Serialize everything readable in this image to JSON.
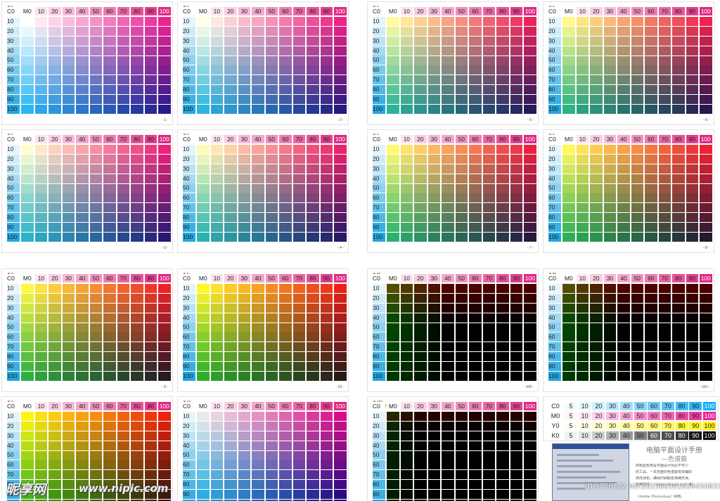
{
  "columns": [
    "M0",
    "10",
    "20",
    "30",
    "40",
    "50",
    "60",
    "70",
    "80",
    "90",
    "100"
  ],
  "rows": [
    "C0",
    "10",
    "20",
    "30",
    "40",
    "50",
    "60",
    "70",
    "80",
    "90",
    "100"
  ],
  "charts": [
    {
      "b": "B 0",
      "y": "Y 0",
      "yv": 0,
      "bv": 0,
      "page": "- 1 -"
    },
    {
      "b": "B 0",
      "y": "Y 10",
      "yv": 10,
      "bv": 0,
      "page": "- 2 -"
    },
    {
      "b": "B 0",
      "y": "Y 40",
      "yv": 40,
      "bv": 0,
      "page": "- 5 -"
    },
    {
      "b": "B 0",
      "y": "Y 50",
      "yv": 50,
      "bv": 0,
      "page": "- 6 -"
    },
    {
      "b": "B 0",
      "y": "Y 20",
      "yv": 20,
      "bv": 0,
      "page": "- 3 -"
    },
    {
      "b": "B 0",
      "y": "Y 30",
      "yv": 30,
      "bv": 0,
      "page": "- 4 -"
    },
    {
      "b": "B 0",
      "y": "Y 60",
      "yv": 60,
      "bv": 0,
      "page": "- 7 -"
    },
    {
      "b": "B 0",
      "y": "Y 70",
      "yv": 70,
      "bv": 0,
      "page": "- 8 -"
    },
    {
      "b": "B 0",
      "y": "Y 80",
      "yv": 80,
      "bv": 0,
      "page": "- 9 -"
    },
    {
      "b": "B 0",
      "y": "Y 90",
      "yv": 90,
      "bv": 0,
      "page": "- 10 -"
    },
    {
      "b": "B 80",
      "y": "Y 90",
      "yv": 90,
      "bv": 80,
      "page": "- 109 -"
    },
    {
      "b": "B 80",
      "y": "Y 100",
      "yv": 100,
      "bv": 80,
      "page": "- 110 -"
    },
    {
      "b": "B 0",
      "y": "Y 100",
      "yv": 100,
      "bv": 0,
      "page": ""
    },
    {
      "b": "B 10",
      "y": "Y 0",
      "yv": 0,
      "bv": 10,
      "page": ""
    },
    {
      "b": "B 100",
      "y": "Y 0-100",
      "yv": 50,
      "bv": 100,
      "page": ""
    }
  ],
  "bank": {
    "values": [
      "5",
      "10",
      "20",
      "30",
      "40",
      "50",
      "60",
      "70",
      "80",
      "90",
      "100"
    ],
    "rows": [
      {
        "label": "C0",
        "kind": "c"
      },
      {
        "label": "M0",
        "kind": "m"
      },
      {
        "label": "Y0",
        "kind": "y"
      },
      {
        "label": "K0",
        "kind": "k"
      }
    ]
  },
  "manual": {
    "title": "电脑平面设计手册",
    "subtitle": "—色谱篇",
    "lines": [
      "四色配色表是平面设计师必不可少",
      "的工具。一本完整的色谱能有效辅助",
      "修改调色，确保印刷颜色准确无误。",
      "常用软件：（Adobe Illustrator）和",
      "（Adobe Photoshop）网用。"
    ]
  },
  "watermark": {
    "logo": "昵享网",
    "url": "www.nipic.com",
    "id": "ID:3736722 NO:20130630185945083398"
  },
  "colors": {
    "header_m": [
      "#ffffff",
      "#fbe4ef",
      "#f8cfe2",
      "#f5bbd6",
      "#f2a8cb",
      "#ee92bd",
      "#ea7eb1",
      "#e769a6",
      "#e3559a",
      "#e0408e",
      "#dd2a82"
    ],
    "row_c": [
      "#ffffff",
      "#e6f4fb",
      "#d0ebf8",
      "#bce3f5",
      "#a7daf2",
      "#90d1ef",
      "#7ac9ec",
      "#64c0e9",
      "#4fb8e6",
      "#39afe3",
      "#22a6e0"
    ]
  }
}
